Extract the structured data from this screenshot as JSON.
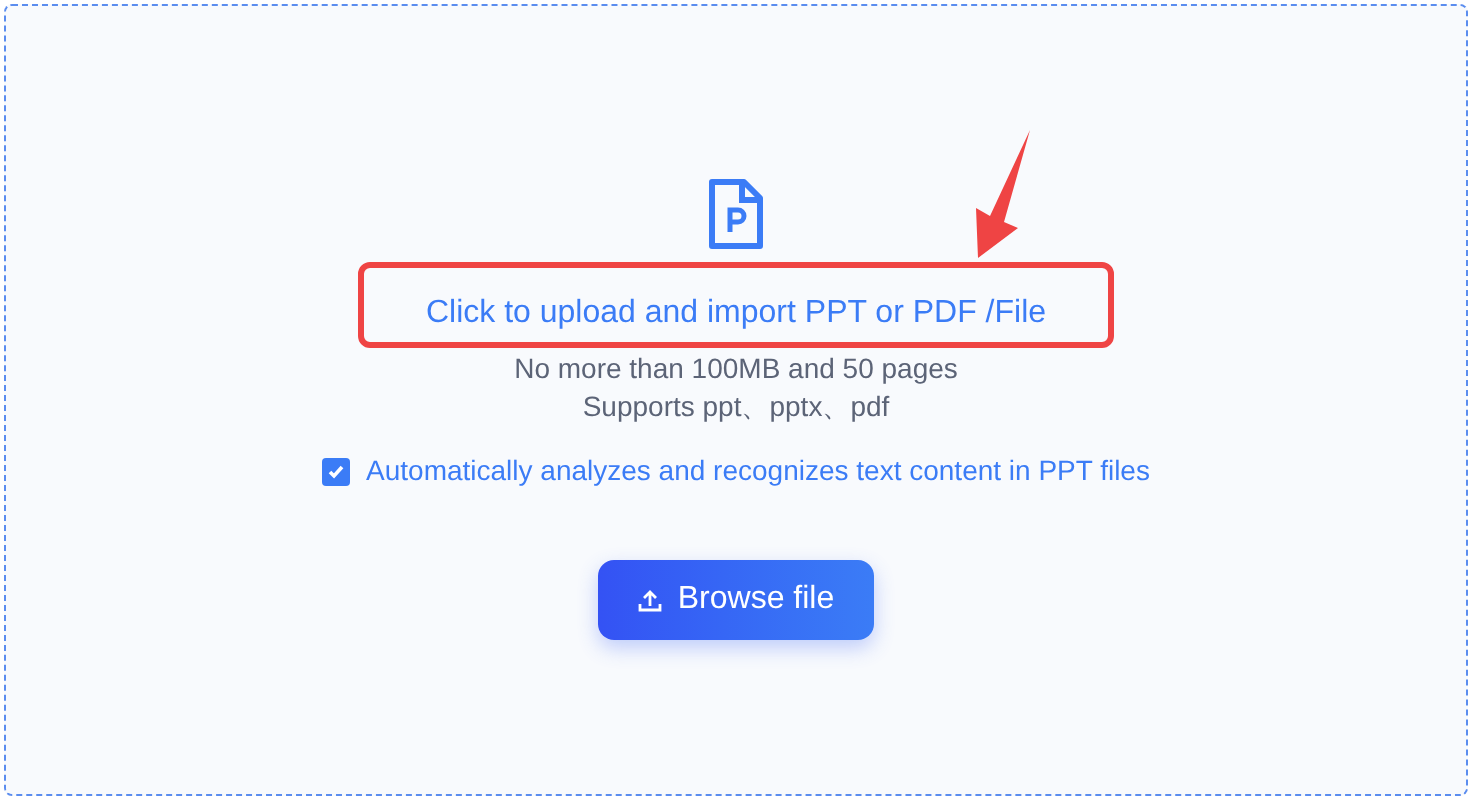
{
  "upload": {
    "link": "Click to upload and import PPT or PDF /File",
    "limits": "No more than 100MB and 50 pages",
    "formats": "Supports ppt、pptx、pdf",
    "option": {
      "label": "Automatically analyzes and recognizes text content in PPT files",
      "checked": true
    },
    "button": "Browse file"
  }
}
